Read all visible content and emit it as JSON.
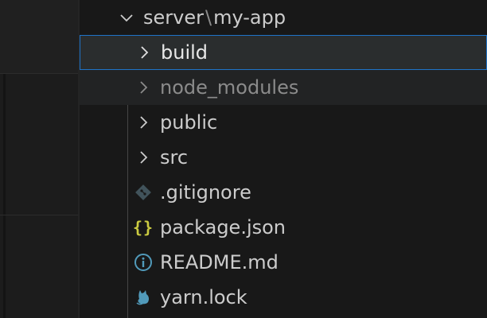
{
  "explorer": {
    "root_folder": {
      "part1": "server",
      "separator": "\\",
      "part2": "my-app",
      "expanded": true
    },
    "items": [
      {
        "label": "build",
        "type": "folder",
        "state": "selected",
        "icon": "chevron-right-icon"
      },
      {
        "label": "node_modules",
        "type": "folder",
        "state": "dimmed",
        "icon": "chevron-right-icon"
      },
      {
        "label": "public",
        "type": "folder",
        "state": "normal",
        "icon": "chevron-right-icon"
      },
      {
        "label": "src",
        "type": "folder",
        "state": "normal",
        "icon": "chevron-right-icon"
      },
      {
        "label": ".gitignore",
        "type": "file",
        "state": "normal",
        "icon": "git-icon"
      },
      {
        "label": "package.json",
        "type": "file",
        "state": "normal",
        "icon": "json-braces-icon"
      },
      {
        "label": "README.md",
        "type": "file",
        "state": "normal",
        "icon": "info-icon"
      },
      {
        "label": "yarn.lock",
        "type": "file",
        "state": "normal",
        "icon": "yarn-cat-icon"
      }
    ],
    "json_icon_text": "{}"
  },
  "colors": {
    "background": "#181818",
    "text": "#cccccc",
    "dimmed_text": "#8b8b8b",
    "selection_border": "#1f74c9",
    "selection_background": "#2a2d2e",
    "git_icon": "#41535b",
    "json_icon": "#cbcb41",
    "info_icon": "#519aba",
    "yarn_icon": "#519aba"
  }
}
